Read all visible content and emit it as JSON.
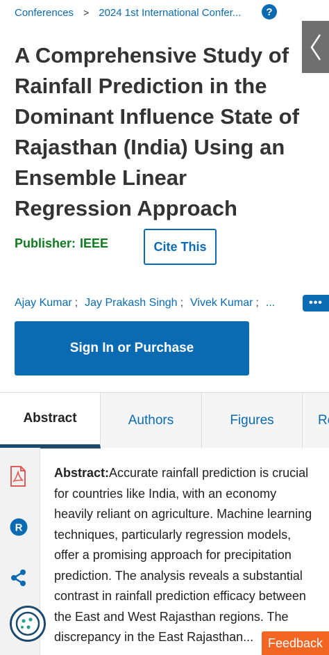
{
  "breadcrumb": {
    "root": "Conferences",
    "separator": ">",
    "current": "2024 1st International Confer..."
  },
  "help_icon": "?",
  "title": "A Comprehensive Study of Rainfall Prediction in the Dominant Influence State of Rajasthan (India) Using an Ensemble Linear Regression Approach",
  "publisher": {
    "label": "Publisher:",
    "name": "IEEE"
  },
  "cite_label": "Cite This",
  "authors": [
    "Ajay Kumar",
    "Jay Prakash Singh",
    "Vivek Kumar"
  ],
  "authors_semicolon": ";",
  "authors_more": "...",
  "more_button": "•••",
  "sign_in_label": "Sign In or Purchase",
  "tabs": [
    {
      "label": "Abstract",
      "active": true
    },
    {
      "label": "Authors",
      "active": false
    },
    {
      "label": "Figures",
      "active": false
    },
    {
      "label": "Re",
      "active": false
    }
  ],
  "rail_icons": [
    "pdf-icon",
    "r-icon",
    "share-icon"
  ],
  "abstract": {
    "label": "Abstract:",
    "text": "Accurate rainfall prediction is crucial for countries like India, with an economy heavily reliant on agriculture. Machine learning techniques, particularly regression models, offer a promising approach for precipitation prediction. The analysis reveals a substantial contrast in rainfall prediction efficacy between the East and West Rajasthan regions. The discrepancy in the East Rajasthan..."
  },
  "feedback_label": "Feedback",
  "colors": {
    "link": "#0a6bb3",
    "publisher": "#0f7a1f",
    "tab_underline": "#1b4a6e",
    "feedback": "#f26522",
    "side_tab": "#6f6f6f"
  }
}
